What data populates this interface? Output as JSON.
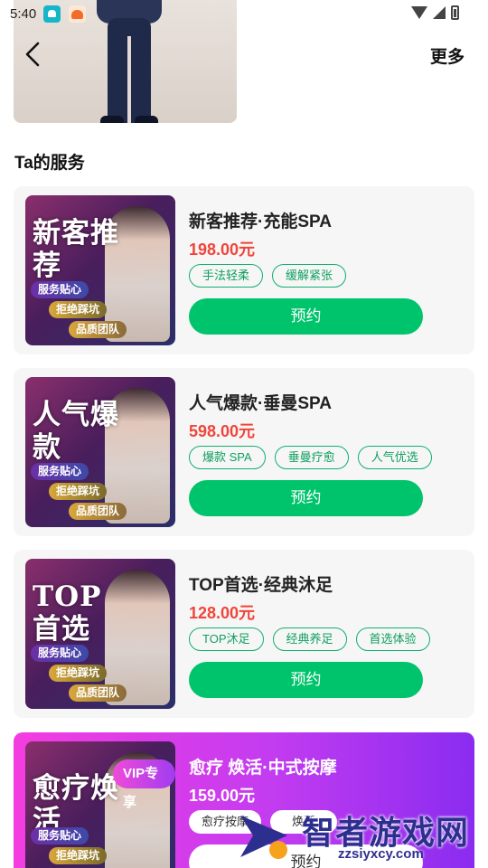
{
  "status_bar": {
    "time": "5:40",
    "icons": [
      "app-icon-teal",
      "app-icon-orange",
      "wifi-icon",
      "signal-icon",
      "battery-icon"
    ]
  },
  "header": {
    "back_icon": "chevron-left-icon",
    "more_label": "更多"
  },
  "section_title": "Ta的服务",
  "services": [
    {
      "thumb_headline": "新客推荐",
      "thumb_pills": [
        "服务贴心",
        "拒绝踩坑",
        "品质团队"
      ],
      "name": "新客推荐·充能SPA",
      "price": "198.00元",
      "tags": [
        "手法轻柔",
        "缓解紧张"
      ],
      "button": "预约"
    },
    {
      "thumb_headline": "人气爆款",
      "thumb_pills": [
        "服务贴心",
        "拒绝踩坑",
        "品质团队"
      ],
      "name": "人气爆款·垂曼SPA",
      "price": "598.00元",
      "tags": [
        "爆款 SPA",
        "垂曼疗愈",
        "人气优选"
      ],
      "button": "预约"
    },
    {
      "thumb_headline": "TOP首选",
      "thumb_pills": [
        "服务贴心",
        "拒绝踩坑",
        "品质团队"
      ],
      "name": "TOP首选·经典沐足",
      "price": "128.00元",
      "tags": [
        "TOP沐足",
        "经典养足",
        "首选体验"
      ],
      "button": "预约"
    },
    {
      "vip_badge": "VIP专享",
      "thumb_headline": "愈疗焕活",
      "thumb_pills": [
        "服务贴心",
        "拒绝踩坑"
      ],
      "name": "愈疗 焕活·中式按摩",
      "price": "159.00元",
      "tags": [
        "愈疗按摩",
        "焕活"
      ],
      "button": "预约"
    }
  ],
  "watermark": {
    "name": "智者游戏网",
    "url": "zzsiyxcy.com"
  },
  "colors": {
    "accent_green": "#00c46c",
    "price_red": "#f0453a",
    "vip_magenta": "#f43de0",
    "vip_purple": "#8a2cf0"
  }
}
